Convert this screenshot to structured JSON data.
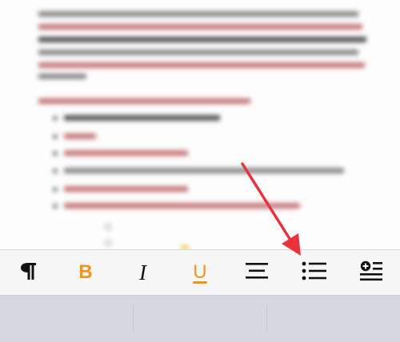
{
  "toolbar": {
    "items": [
      {
        "id": "paragraph",
        "icon": "pilcrow-icon",
        "glyph": "¶"
      },
      {
        "id": "bold",
        "icon": "bold-icon",
        "glyph": "B",
        "active": true
      },
      {
        "id": "italic",
        "icon": "italic-icon",
        "glyph": "I"
      },
      {
        "id": "underline",
        "icon": "underline-icon",
        "glyph": "U",
        "active": true
      },
      {
        "id": "align",
        "icon": "align-center-icon"
      },
      {
        "id": "list",
        "icon": "bulleted-list-icon"
      },
      {
        "id": "insert",
        "icon": "insert-line-icon"
      }
    ],
    "accent_color": "#f0931a"
  },
  "annotation": {
    "type": "arrow",
    "target": "list",
    "color": "#e8323c"
  }
}
